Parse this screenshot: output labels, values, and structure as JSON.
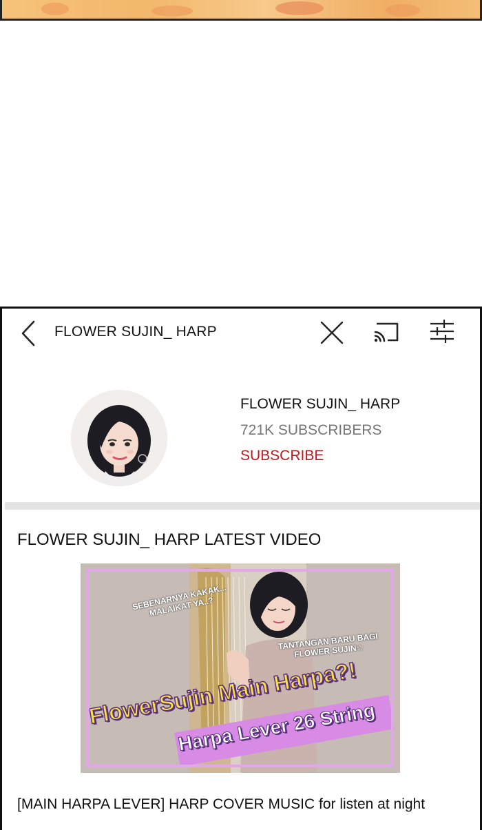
{
  "header": {
    "title": "FLOWER SUJIN_ HARP",
    "icons": [
      "chevron-left-icon",
      "close-icon",
      "cast-icon",
      "filter-sliders-icon"
    ]
  },
  "channel": {
    "name": "FLOWER SUJIN_ HARP",
    "subscribers": "721K SUBSCRIBERS",
    "subscribe_label": "SUBSCRIBE"
  },
  "latest": {
    "section_title": "FLOWER SUJIN_ HARP LATEST VIDEO",
    "thumbnail": {
      "caption_top": "SEBENARNYA KAKAK... MALAIKAT YA..?",
      "caption_right": "TANTANGAN BARU BAGI FLOWER SUJIN☆",
      "headline_1": "FlowerSujin Main Harpa?!",
      "headline_2": "Harpa Lever 26 String"
    },
    "video_title": "[MAIN HARPA LEVER] HARP COVER MUSIC for listen at night"
  },
  "colors": {
    "subscribe": "#c0181d",
    "subscribers": "#777777",
    "thumb_border": "#e2a7e8",
    "headline": "#f7e04a"
  }
}
